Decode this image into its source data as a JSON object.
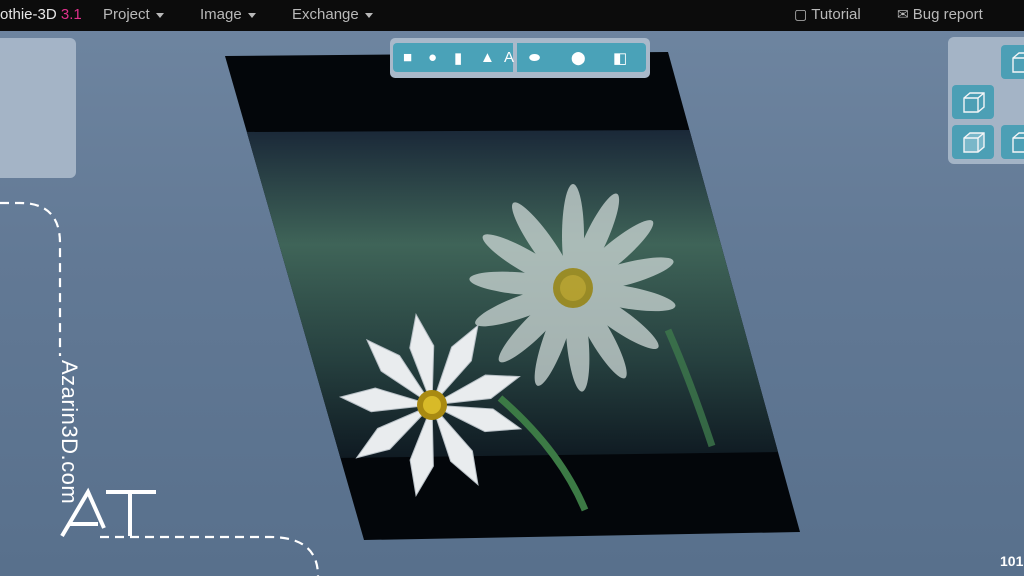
{
  "menubar": {
    "app_name": "othie-3D",
    "app_version": "3.1",
    "menus": [
      {
        "label": "Project"
      },
      {
        "label": "Image"
      },
      {
        "label": "Exchange"
      }
    ],
    "tutorial_label": "Tutorial",
    "bug_report_label": "Bug report"
  },
  "toolbar": {
    "shape_text_label": "A"
  },
  "watermark": {
    "site": "Azarin3D.com",
    "logo_text": "AT"
  },
  "corner_counter": "101",
  "colors": {
    "menubar_bg": "#0c0c0c",
    "version_accent": "#e0308c",
    "button_teal": "#4aa2b8",
    "panel_gray": "#a9b9ca",
    "canvas_bg": "#6a819c"
  }
}
